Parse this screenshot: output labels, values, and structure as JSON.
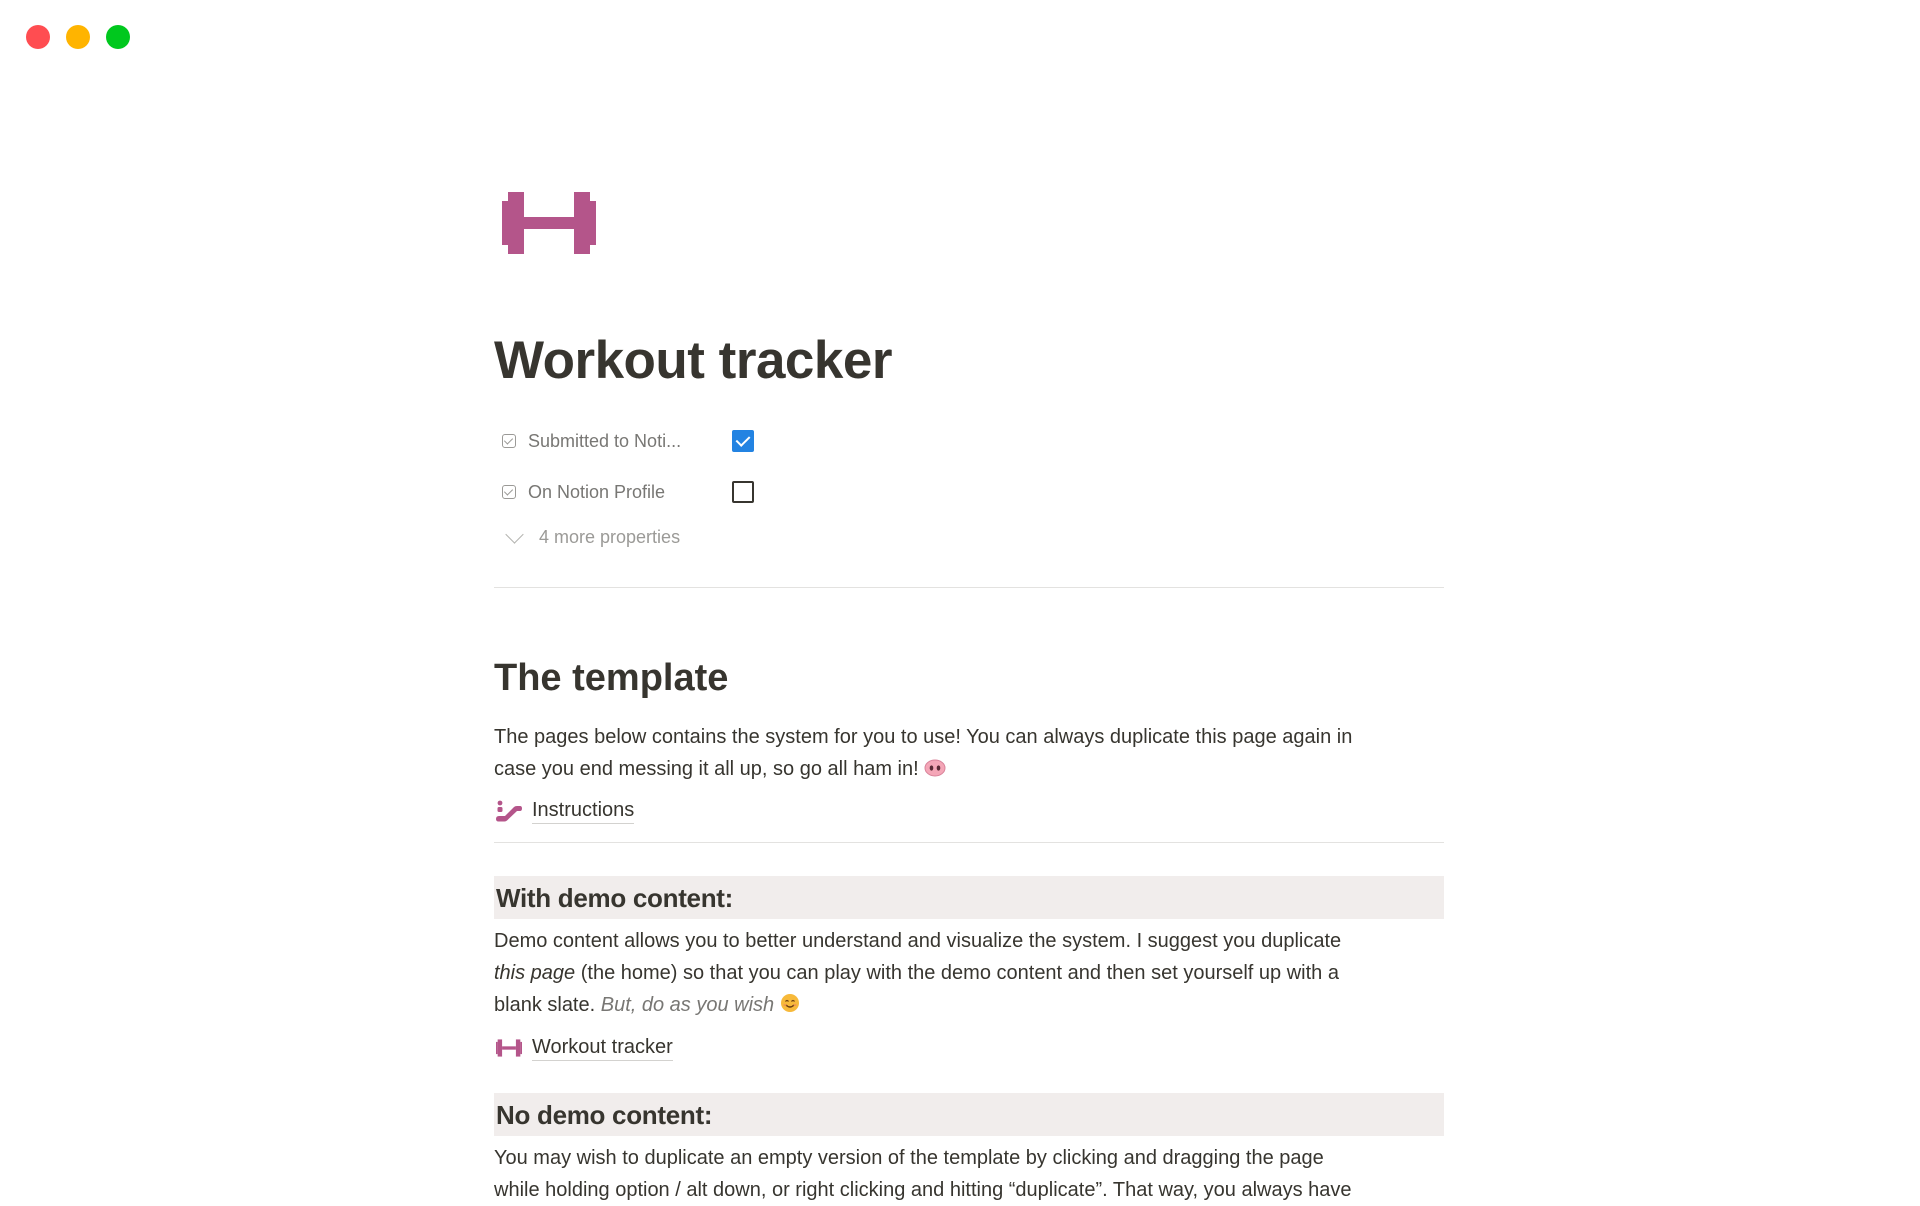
{
  "window": {
    "controls": [
      "close",
      "minimize",
      "zoom"
    ]
  },
  "page": {
    "icon": "dumbbell-icon",
    "title": "Workout tracker",
    "properties": [
      {
        "type_icon": "checkbox-property-icon",
        "label": "Submitted to Noti...",
        "checked": true
      },
      {
        "type_icon": "checkbox-property-icon",
        "label": "On Notion Profile",
        "checked": false
      }
    ],
    "more_properties_label": "4 more properties"
  },
  "content": {
    "template_heading": "The template",
    "template_paragraph": {
      "line1": "The pages below contains the system for you to use! You can always duplicate this page again in",
      "line2": "case you end messing it all up, so go all ham in!",
      "emoji": "pig-nose-icon"
    },
    "instructions_link": {
      "icon": "escalator-icon",
      "label": "Instructions"
    },
    "demo_section": {
      "heading": "With demo content:",
      "line1": "Demo content allows you to better understand and visualize the system. I suggest you duplicate",
      "line2_italic": "this page",
      "line2_rest": " (the home) so that you can play with the demo content and then set yourself up with a",
      "line3_plain": "blank slate. ",
      "line3_italic": "But, do as you wish",
      "emoji": "smiling-face-icon"
    },
    "workout_tracker_link": {
      "icon": "dumbbell-icon",
      "label": "Workout tracker"
    },
    "no_demo_section": {
      "heading": "No demo content:",
      "line1": "You may wish to duplicate an empty version of the template by clicking and dragging the page",
      "line2": "while holding option / alt down, or right clicking and hitting “duplicate”. That way, you always have"
    }
  },
  "colors": {
    "accent_pink": "#b4558a",
    "checkbox_blue": "#2383e2",
    "callout_bg": "#f1edec",
    "text": "#37352f",
    "muted": "#787774"
  }
}
